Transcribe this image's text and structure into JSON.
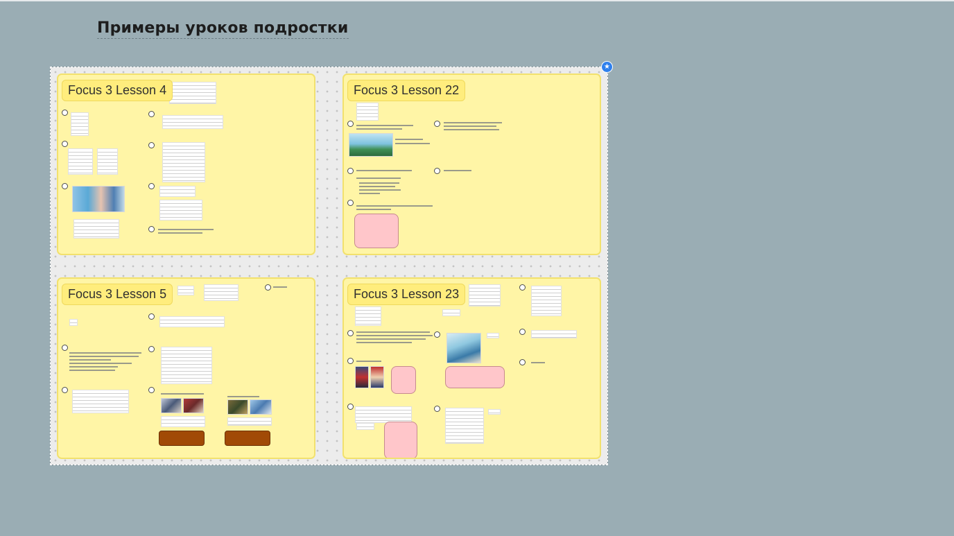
{
  "page": {
    "title": "Примеры уроков подростки"
  },
  "board": {
    "cards": [
      {
        "title": "Focus 3 Lesson 4"
      },
      {
        "title": "Focus 3 Lesson 22"
      },
      {
        "title": "Focus 3 Lesson 5"
      },
      {
        "title": "Focus 3 Lesson 23"
      }
    ]
  },
  "icons": {
    "board_badge": "star-badge-icon"
  },
  "colors": {
    "background": "#9aadb4",
    "card_fill": "#fff5a6",
    "card_border": "#f2e16d",
    "title_tag": "#ffed7d",
    "pink_note": "#ffc6ca",
    "brown_button": "#a14a06",
    "accent_badge": "#2f80ed"
  }
}
